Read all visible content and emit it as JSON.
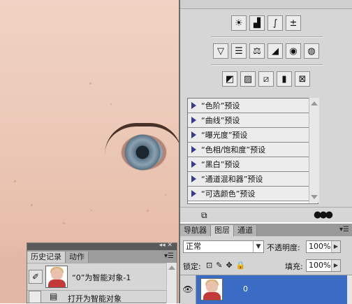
{
  "adjustments": {
    "row1_icons": [
      "brightness-contrast-icon",
      "levels-icon",
      "curves-icon",
      "exposure-icon"
    ],
    "row2_icons": [
      "vibrance-icon",
      "hue-saturation-icon",
      "color-balance-icon",
      "black-white-icon",
      "photo-filter-icon",
      "channel-mixer-icon"
    ],
    "row3_icons": [
      "invert-icon",
      "posterize-icon",
      "threshold-icon",
      "gradient-map-icon",
      "selective-color-icon"
    ],
    "presets": [
      {
        "label": "“色阶”预设"
      },
      {
        "label": "“曲线”预设"
      },
      {
        "label": "“曝光度”预设"
      },
      {
        "label": "“色相/饱和度”预设"
      },
      {
        "label": "“黑白”预设"
      },
      {
        "label": "“通道混和器”预设"
      },
      {
        "label": "“可选颜色”预设"
      }
    ]
  },
  "layers_panel": {
    "tabs": [
      "导航器",
      "图层",
      "通道"
    ],
    "active_tab": "图层",
    "blend_mode": "正常",
    "opacity_label": "不透明度:",
    "opacity_value": "100%",
    "lock_label": "锁定:",
    "fill_label": "填充:",
    "fill_value": "100%",
    "layer_name": "0",
    "selection_color": "#3a6bc5"
  },
  "history_panel": {
    "tabs": [
      "历史记录",
      "动作"
    ],
    "active_tab": "历史记录",
    "snapshot_label": "“0”为智能对象-1",
    "items": [
      {
        "label": "打开为智能对象"
      }
    ]
  }
}
